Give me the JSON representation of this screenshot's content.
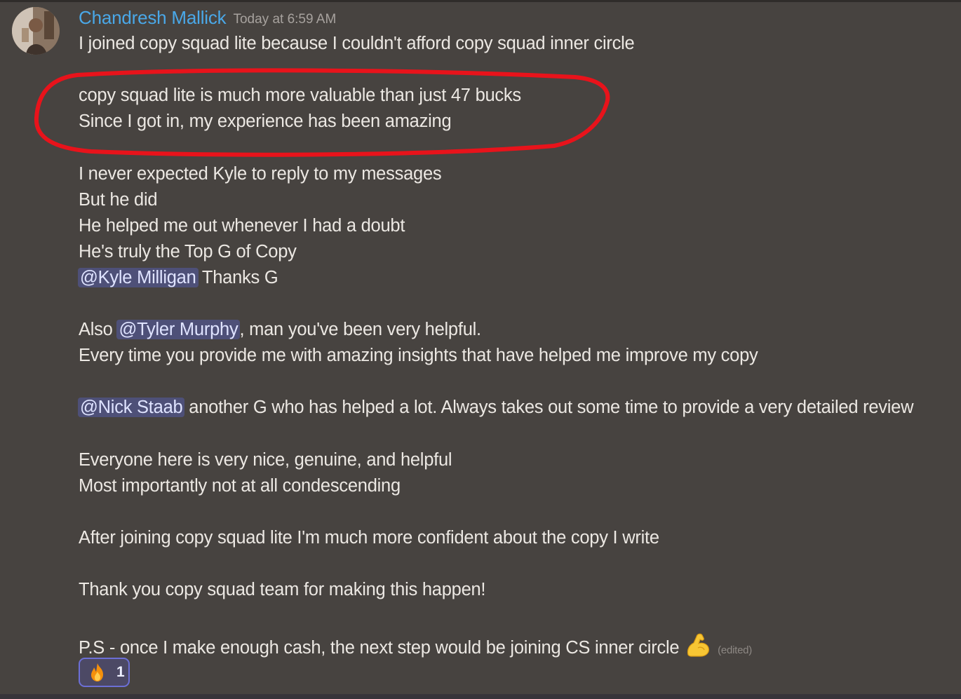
{
  "message": {
    "author": "Chandresh Mallick",
    "timestamp": "Today at 6:59 AM",
    "lines": {
      "l1": "I joined copy squad lite because I couldn't afford copy squad inner circle",
      "l2": "copy squad lite is much more valuable than just 47 bucks",
      "l3": "Since I got in, my experience has been amazing",
      "l4": "I never expected Kyle to reply to my messages",
      "l5": "But he did",
      "l6": "He helped me out whenever I had a doubt",
      "l7": "He's truly the Top G of Copy",
      "l8_mention": "@Kyle Milligan",
      "l8_text": " Thanks G",
      "l9_pre": "Also ",
      "l9_mention": "@Tyler Murphy",
      "l9_text": ", man you've been very helpful.",
      "l10": "Every time you provide me with amazing insights that have helped me improve my copy",
      "l11_mention": "@Nick Staab",
      "l11_text": " another G who has helped a lot. Always takes out some time to provide a very detailed review",
      "l12": "Everyone here is very nice, genuine, and helpful",
      "l13": "Most importantly not at all condescending",
      "l14": "After joining copy squad lite I'm much more confident about the copy I write",
      "l15": "Thank you copy squad team for making this happen!",
      "l16": "P.S - once I make enough cash, the next step would be joining CS inner circle"
    },
    "edited_label": "(edited)",
    "emoji": "flexed-biceps-icon",
    "reaction": {
      "emoji": "fire-icon",
      "count": "1"
    }
  },
  "colors": {
    "background": "#474340",
    "username": "#4aa8e8",
    "text": "#ece8e3",
    "mention_bg": "#4e5078",
    "annotation": "#e8131b"
  }
}
